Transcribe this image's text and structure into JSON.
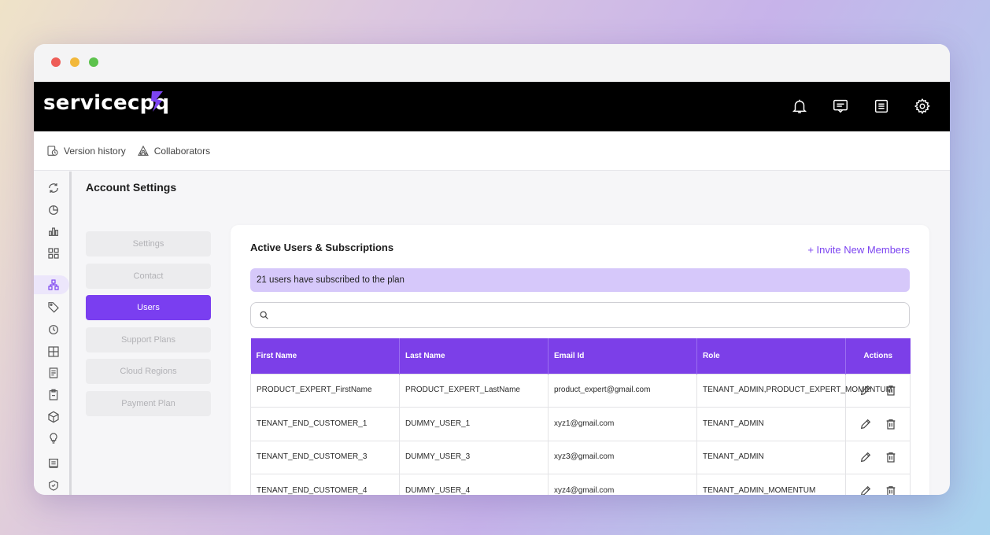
{
  "brand": {
    "name": "servicecpq",
    "accent": "#7c3fe8"
  },
  "topnav": {
    "icons": [
      "bell-icon",
      "message-icon",
      "list-icon",
      "gear-icon"
    ]
  },
  "subbar": {
    "version_history": "Version history",
    "collaborators": "Collaborators"
  },
  "page": {
    "title": "Account Settings"
  },
  "settings_menu": {
    "items": [
      {
        "label": "Settings",
        "active": false
      },
      {
        "label": "Contact",
        "active": false
      },
      {
        "label": "Users",
        "active": true
      },
      {
        "label": "Support Plans",
        "active": false
      },
      {
        "label": "Cloud Regions",
        "active": false
      },
      {
        "label": "Payment Plan",
        "active": false
      }
    ]
  },
  "card": {
    "title": "Active Users & Subscriptions",
    "invite_label": "+ Invite New Members",
    "banner": "21 users have subscribed to the plan",
    "search_placeholder": ""
  },
  "table": {
    "headers": [
      "First Name",
      "Last Name",
      "Email Id",
      "Role",
      "Actions"
    ],
    "rows": [
      [
        "PRODUCT_EXPERT_FirstName",
        "PRODUCT_EXPERT_LastName",
        "product_expert@gmail.com",
        "TENANT_ADMIN,PRODUCT_EXPERT_MOMENTUM"
      ],
      [
        "TENANT_END_CUSTOMER_1",
        "DUMMY_USER_1",
        "xyz1@gmail.com",
        "TENANT_ADMIN"
      ],
      [
        "TENANT_END_CUSTOMER_3",
        "DUMMY_USER_3",
        "xyz3@gmail.com",
        "TENANT_ADMIN"
      ],
      [
        "TENANT_END_CUSTOMER_4",
        "DUMMY_USER_4",
        "xyz4@gmail.com",
        "TENANT_ADMIN_MOMENTUM"
      ]
    ]
  }
}
